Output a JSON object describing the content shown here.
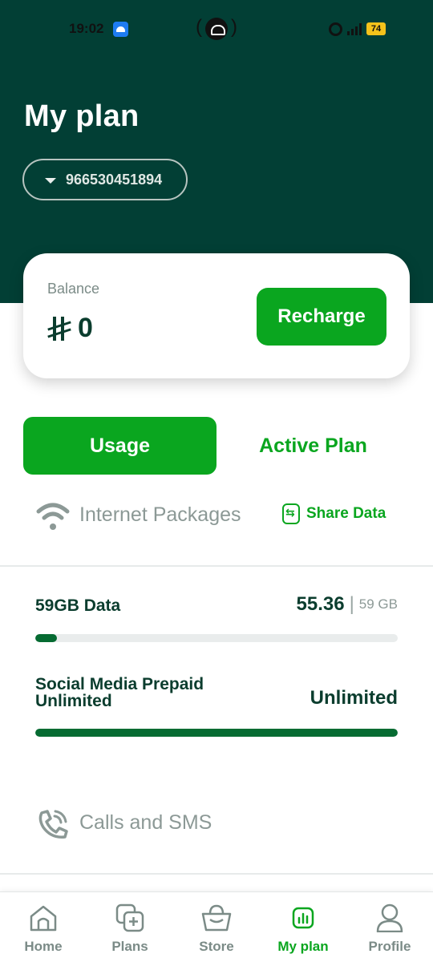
{
  "status_bar": {
    "time": "19:02",
    "battery": "74",
    "icons": [
      "app-notification-icon",
      "cast-icon",
      "alarm-icon",
      "signal-icon",
      "battery-icon"
    ]
  },
  "header": {
    "title": "My plan",
    "phone_number": "966530451894"
  },
  "balance": {
    "label": "Balance",
    "value": "0",
    "currency_icon": "saudi-riyal-icon",
    "recharge_label": "Recharge"
  },
  "tabs": [
    {
      "label": "Usage",
      "active": true
    },
    {
      "label": "Active Plan",
      "active": false
    }
  ],
  "internet": {
    "title": "Internet Packages",
    "share_label": "Share Data",
    "items": [
      {
        "name": "59GB Data",
        "used": "55.36",
        "total": "59 GB",
        "progress": 0.06
      },
      {
        "name": "Social Media Prepaid Unlimited",
        "used": "Unlimited",
        "progress": 1.0
      }
    ]
  },
  "calls": {
    "title": "Calls and SMS"
  },
  "bottom_nav": [
    {
      "label": "Home",
      "icon": "home-icon",
      "active": false
    },
    {
      "label": "Plans",
      "icon": "plans-icon",
      "active": false
    },
    {
      "label": "Store",
      "icon": "store-icon",
      "active": false
    },
    {
      "label": "My plan",
      "icon": "my-plan-icon",
      "active": true
    },
    {
      "label": "Profile",
      "icon": "profile-icon",
      "active": false
    }
  ],
  "colors": {
    "header_bg": "#023f35",
    "accent_green": "#0aa61f",
    "progress_green": "#066b32",
    "text_dark": "#0b3d2e",
    "muted": "#8c9996"
  }
}
